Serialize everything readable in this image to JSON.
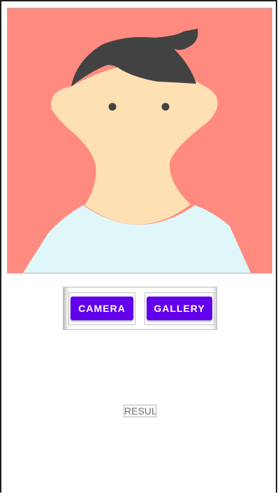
{
  "image_view": {
    "content": "cartoon-person-avatar",
    "background_color": "#ff8a80",
    "hair_color": "#424242",
    "skin_color": "#ffe0b2",
    "shirt_color": "#e0f7fa"
  },
  "buttons": {
    "camera_label": "Camera",
    "gallery_label": "Gallery",
    "color": "#6200ee"
  },
  "result": {
    "text": "RESULT"
  }
}
